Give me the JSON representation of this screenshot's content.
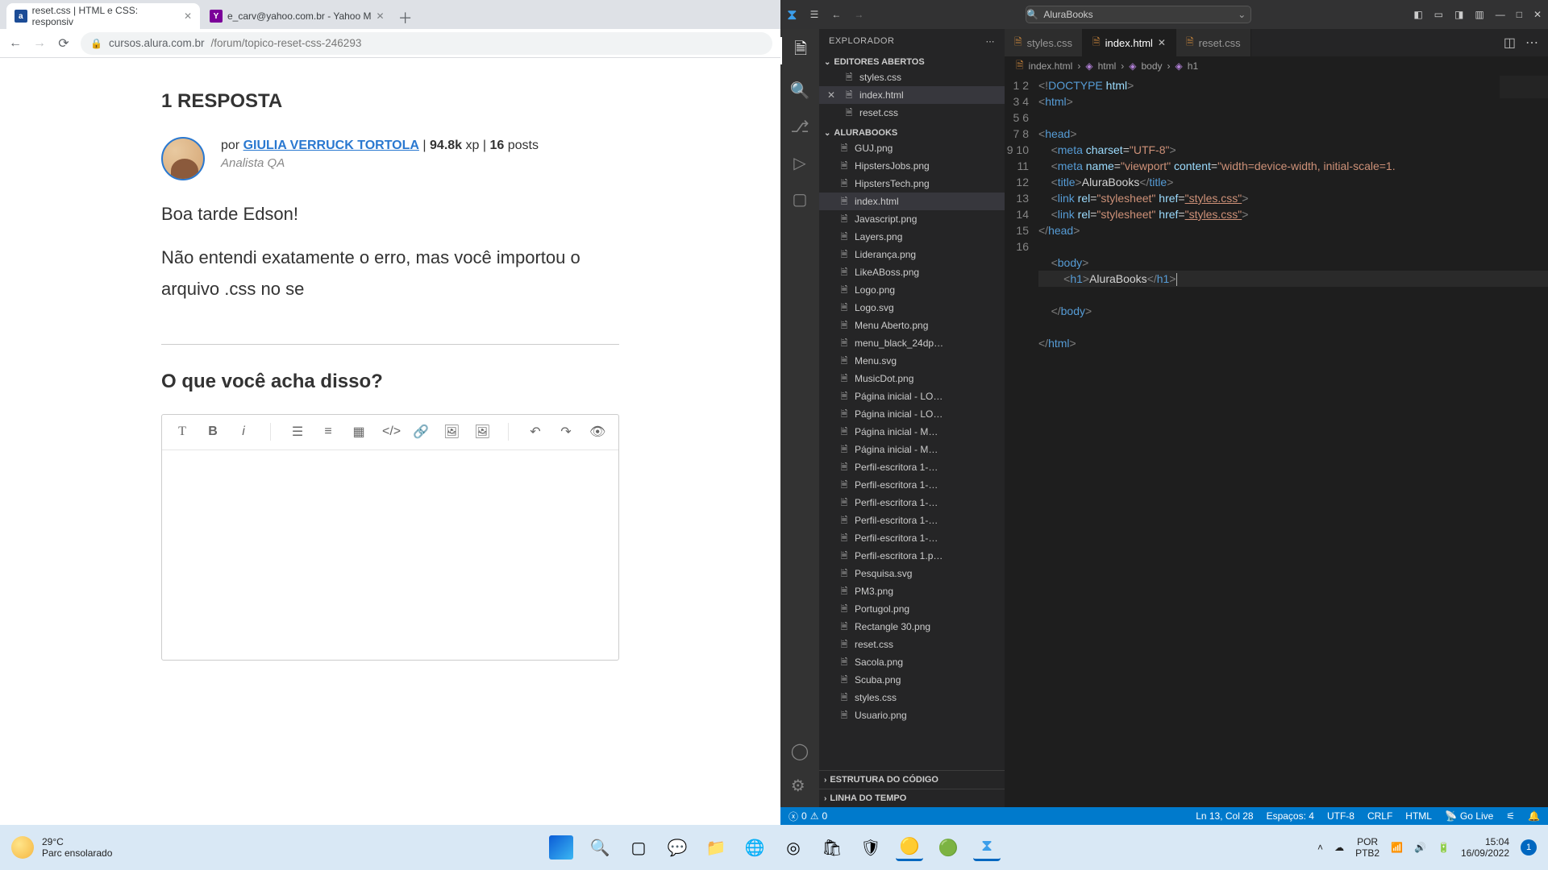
{
  "chrome": {
    "tabs": [
      {
        "title": "reset.css | HTML e CSS: responsiv",
        "favicon": "a"
      },
      {
        "title": "e_carv@yahoo.com.br - Yahoo M",
        "favicon": "Y"
      }
    ],
    "url_host": "cursos.alura.com.br",
    "url_path": "/forum/topico-reset-css-246293"
  },
  "forum": {
    "resposta_label": "1 RESPOSTA",
    "author_prefix": "por ",
    "author_name": "GIULIA VERRUCK TORTOLA",
    "meta_xp_value": "94.8k",
    "meta_xp_label": " xp",
    "meta_separator": " | ",
    "meta_posts_value": "16",
    "meta_posts_label": " posts",
    "author_role": "Analista QA",
    "body_line1": "Boa tarde Edson!",
    "body_line2": "Não entendi exatamente o erro, mas você importou o arquivo .css no se",
    "opinion_heading": "O que você acha disso?"
  },
  "vscode": {
    "command_center": "AluraBooks",
    "explorer_label": "EXPLORADOR",
    "sections": {
      "open_editors": "EDITORES ABERTOS",
      "folder": "ALURABOOKS",
      "outline": "ESTRUTURA DO CÓDIGO",
      "timeline": "LINHA DO TEMPO"
    },
    "open_editors": [
      "styles.css",
      "index.html",
      "reset.css"
    ],
    "open_editor_active": "index.html",
    "files": [
      "GUJ.png",
      "HipstersJobs.png",
      "HipstersTech.png",
      "index.html",
      "Javascript.png",
      "Layers.png",
      "Liderança.png",
      "LikeABoss.png",
      "Logo.png",
      "Logo.svg",
      "Menu Aberto.png",
      "menu_black_24dp…",
      "Menu.svg",
      "MusicDot.png",
      "Página inicial - LO…",
      "Página inicial - LO…",
      "Página inicial - M…",
      "Página inicial - M…",
      "Perfil-escritora 1-…",
      "Perfil-escritora 1-…",
      "Perfil-escritora 1-…",
      "Perfil-escritora 1-…",
      "Perfil-escritora 1-…",
      "Perfil-escritora 1.p…",
      "Pesquisa.svg",
      "PM3.png",
      "Portugol.png",
      "Rectangle 30.png",
      "reset.css",
      "Sacola.png",
      "Scuba.png",
      "styles.css",
      "Usuario.png"
    ],
    "file_selected": "index.html",
    "tabs": [
      {
        "name": "styles.css",
        "active": false
      },
      {
        "name": "index.html",
        "active": true
      },
      {
        "name": "reset.css",
        "active": false
      }
    ],
    "breadcrumb": [
      "index.html",
      "html",
      "body",
      "h1"
    ],
    "code_title_text": "AluraBooks",
    "status": {
      "errors": "0",
      "warnings": "0",
      "cursor": "Ln 13, Col 28",
      "spaces": "Espaços: 4",
      "encoding": "UTF-8",
      "eol": "CRLF",
      "lang": "HTML",
      "golive": "Go Live"
    }
  },
  "taskbar": {
    "temp": "29°C",
    "weather": "Parc ensolarado",
    "lang1": "POR",
    "lang2": "PTB2",
    "time": "15:04",
    "date": "16/09/2022",
    "notif": "1"
  }
}
